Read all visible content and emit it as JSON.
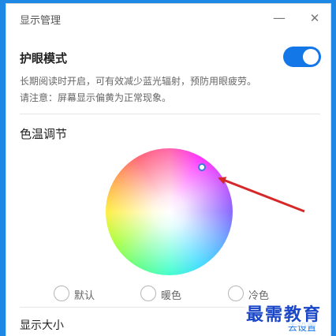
{
  "window": {
    "title": "显示管理",
    "minimize_glyph": "—",
    "close_glyph": "✕"
  },
  "eye_protection": {
    "title": "护眼模式",
    "enabled": true,
    "desc_line1": "长期阅读时开启，可有效减少蓝光辐射，预防用眼疲劳。",
    "desc_line2": "请注意：屏幕显示偏黄为正常现象。"
  },
  "color_temperature": {
    "title": "色温调节",
    "options": [
      {
        "label": "默认"
      },
      {
        "label": "暖色"
      },
      {
        "label": "冷色"
      }
    ]
  },
  "display_size": {
    "title": "显示大小",
    "link": "去设置"
  },
  "watermark": "最需教育",
  "colors": {
    "accent": "#1477e8",
    "arrow": "#d62828",
    "background": "#1e88e5"
  }
}
